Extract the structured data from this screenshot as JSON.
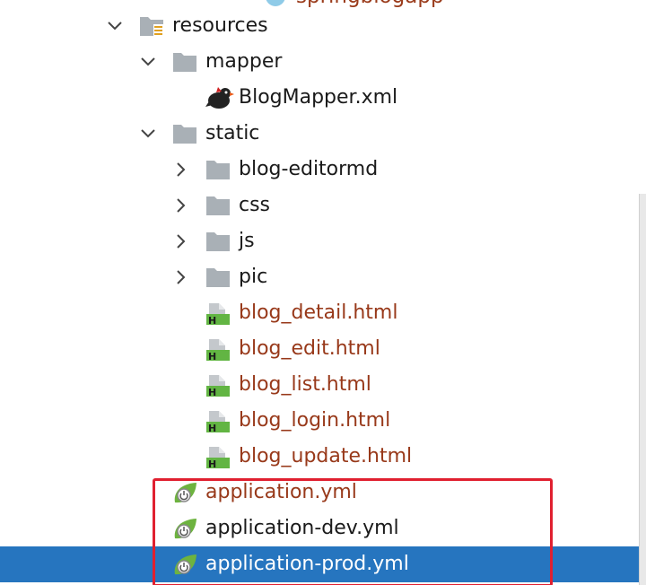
{
  "top_partial_text": "springblogapp",
  "tree": [
    {
      "id": "resources",
      "label": "resources",
      "kind": "resources-folder",
      "chevron": "down",
      "depth": 0,
      "modified": false,
      "selected": false
    },
    {
      "id": "mapper",
      "label": "mapper",
      "kind": "folder",
      "chevron": "down",
      "depth": 1,
      "modified": false,
      "selected": false
    },
    {
      "id": "blogmapper",
      "label": "BlogMapper.xml",
      "kind": "mybatis",
      "chevron": "none",
      "depth": 2,
      "modified": false,
      "selected": false
    },
    {
      "id": "static",
      "label": "static",
      "kind": "folder",
      "chevron": "down",
      "depth": 1,
      "modified": false,
      "selected": false
    },
    {
      "id": "blog-editormd",
      "label": "blog-editormd",
      "kind": "folder",
      "chevron": "right",
      "depth": 2,
      "modified": false,
      "selected": false
    },
    {
      "id": "css",
      "label": "css",
      "kind": "folder",
      "chevron": "right",
      "depth": 2,
      "modified": false,
      "selected": false
    },
    {
      "id": "js",
      "label": "js",
      "kind": "folder",
      "chevron": "right",
      "depth": 2,
      "modified": false,
      "selected": false
    },
    {
      "id": "pic",
      "label": "pic",
      "kind": "folder",
      "chevron": "right",
      "depth": 2,
      "modified": false,
      "selected": false
    },
    {
      "id": "blog_detail",
      "label": "blog_detail.html",
      "kind": "html",
      "chevron": "none",
      "depth": 2,
      "modified": true,
      "selected": false
    },
    {
      "id": "blog_edit",
      "label": "blog_edit.html",
      "kind": "html",
      "chevron": "none",
      "depth": 2,
      "modified": true,
      "selected": false
    },
    {
      "id": "blog_list",
      "label": "blog_list.html",
      "kind": "html",
      "chevron": "none",
      "depth": 2,
      "modified": true,
      "selected": false
    },
    {
      "id": "blog_login",
      "label": "blog_login.html",
      "kind": "html",
      "chevron": "none",
      "depth": 2,
      "modified": true,
      "selected": false
    },
    {
      "id": "blog_update",
      "label": "blog_update.html",
      "kind": "html",
      "chevron": "none",
      "depth": 2,
      "modified": true,
      "selected": false
    },
    {
      "id": "application",
      "label": "application.yml",
      "kind": "spring-yml",
      "chevron": "none",
      "depth": 1,
      "modified": true,
      "selected": false
    },
    {
      "id": "application-dev",
      "label": "application-dev.yml",
      "kind": "spring-yml",
      "chevron": "none",
      "depth": 1,
      "modified": false,
      "selected": false
    },
    {
      "id": "application-prod",
      "label": "application-prod.yml",
      "kind": "spring-yml",
      "chevron": "none",
      "depth": 1,
      "modified": false,
      "selected": true
    }
  ],
  "colors": {
    "selection": "#2675bf",
    "modified_text": "#98391a",
    "highlight_border": "#e02030",
    "folder": "#a9b0b6",
    "spring_green": "#6db33f"
  }
}
